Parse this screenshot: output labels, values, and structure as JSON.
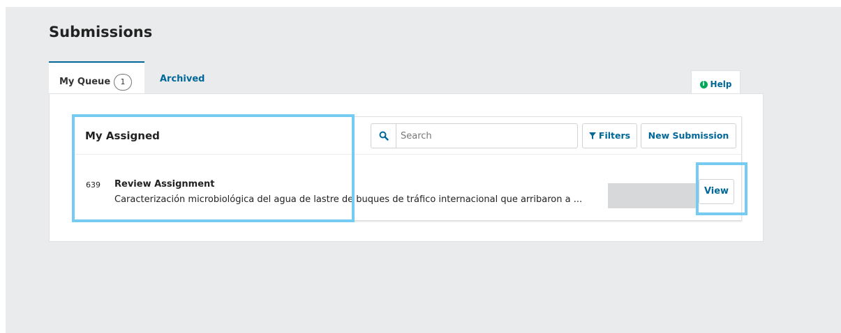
{
  "header": {
    "title": "Submissions"
  },
  "tabs": [
    {
      "label": "My Queue",
      "count": "1",
      "active": true
    },
    {
      "label": "Archived",
      "active": false
    }
  ],
  "help": {
    "label": "Help",
    "icon": "info-circle-icon"
  },
  "list": {
    "title": "My Assigned",
    "search": {
      "placeholder": "Search",
      "value": "",
      "icon": "search-icon"
    },
    "filters_label": "Filters",
    "filters_icon": "filter-icon",
    "new_submission_label": "New Submission"
  },
  "rows": [
    {
      "id": "639",
      "type": "Review Assignment",
      "title": "Caracterización microbiológica del agua de lastre de buques de tráfico internacional que arribaron a ...",
      "action_label": "View"
    }
  ],
  "colors": {
    "accent": "#006798",
    "highlight": "#75cbf2",
    "background": "#e9ebec",
    "help_icon": "#00a85a"
  }
}
